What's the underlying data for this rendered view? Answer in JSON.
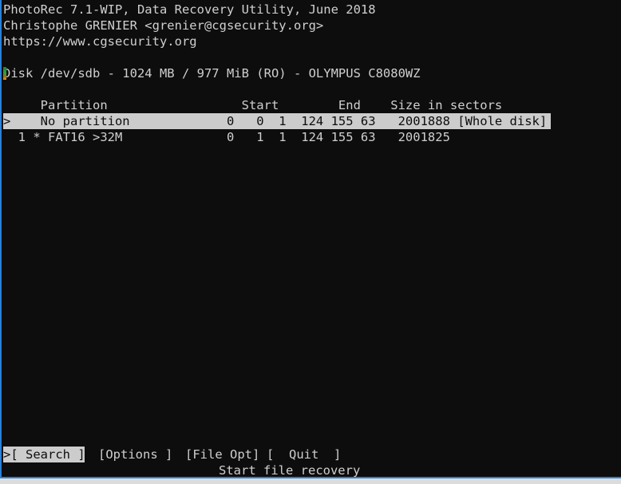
{
  "app": {
    "title": "PhotoRec 7.1-WIP, Data Recovery Utility, June 2018",
    "author": "Christophe GRENIER <grenier@cgsecurity.org>",
    "website": "https://www.cgsecurity.org"
  },
  "disk": {
    "line": "Disk /dev/sdb - 1024 MB / 977 MiB (RO) - OLYMPUS C8080WZ",
    "device": "/dev/sdb",
    "size_mb": "1024 MB",
    "size_mib": "977 MiB",
    "mode": "(RO)",
    "model": "OLYMPUS C8080WZ"
  },
  "table": {
    "header": {
      "partition": "Partition",
      "start": "Start",
      "end": "End",
      "size": "Size in sectors"
    },
    "header_line": "     Partition                  Start        End    Size in sectors",
    "rows": [
      {
        "cursor": ">",
        "selected": true,
        "label": "No partition",
        "start": "0   0  1",
        "end": "124 155 63",
        "sectors": "2001888",
        "note": "[Whole disk]",
        "line": ">    No partition             0   0  1  124 155 63   2001888 [Whole disk]"
      },
      {
        "cursor": " ",
        "selected": false,
        "label": "1 * FAT16 >32M",
        "start": "0   1  1",
        "end": "124 155 63",
        "sectors": "2001825",
        "note": "",
        "line": "  1 * FAT16 >32M              0   1  1  124 155 63   2001825"
      }
    ]
  },
  "menu": {
    "items": [
      {
        "label": ">[ Search ]",
        "name": "search",
        "selected": true
      },
      {
        "label": "[Options ]",
        "name": "options",
        "selected": false
      },
      {
        "label": "[File Opt]",
        "name": "file-opt",
        "selected": false
      },
      {
        "label": "[  Quit  ]",
        "name": "quit",
        "selected": false
      }
    ],
    "hint": "Start file recovery",
    "line": ">[ Search ]  [Options ]  [File Opt]  [  Quit  ]"
  },
  "colors": {
    "background": "#0d0d0d",
    "foreground": "#cfcfcf",
    "highlight_bg": "#cccccc",
    "highlight_fg": "#0d0d0d",
    "window_border": "#2a7fd4",
    "desktop": "#dcdcdc"
  }
}
